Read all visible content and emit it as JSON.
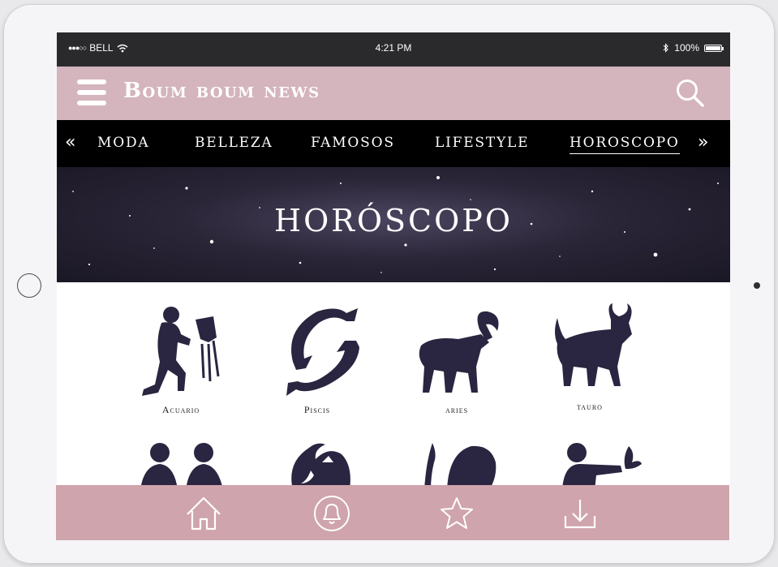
{
  "status_bar": {
    "carrier": "BELL",
    "signal": "●●●○○",
    "time": "4:21 PM",
    "battery": "100%"
  },
  "header": {
    "brand": "Boum boum news"
  },
  "nav": {
    "items": [
      "MODA",
      "BELLEZA",
      "FAMOSOS",
      "LIFESTYLE",
      "HOROSCOPO"
    ],
    "active": "HOROSCOPO"
  },
  "hero": {
    "title": "HORÓSCOPO"
  },
  "zodiac": {
    "row1": [
      "Acuario",
      "Piscis",
      "aries",
      "tauro"
    ]
  },
  "bottom_nav": [
    "home-icon",
    "notification-icon",
    "favorites-icon",
    "download-icon"
  ],
  "colors": {
    "header": "#d4b4bd",
    "bottom_bar": "#cfa4ac",
    "nav": "#000000",
    "silhouette": "#2a2540"
  }
}
